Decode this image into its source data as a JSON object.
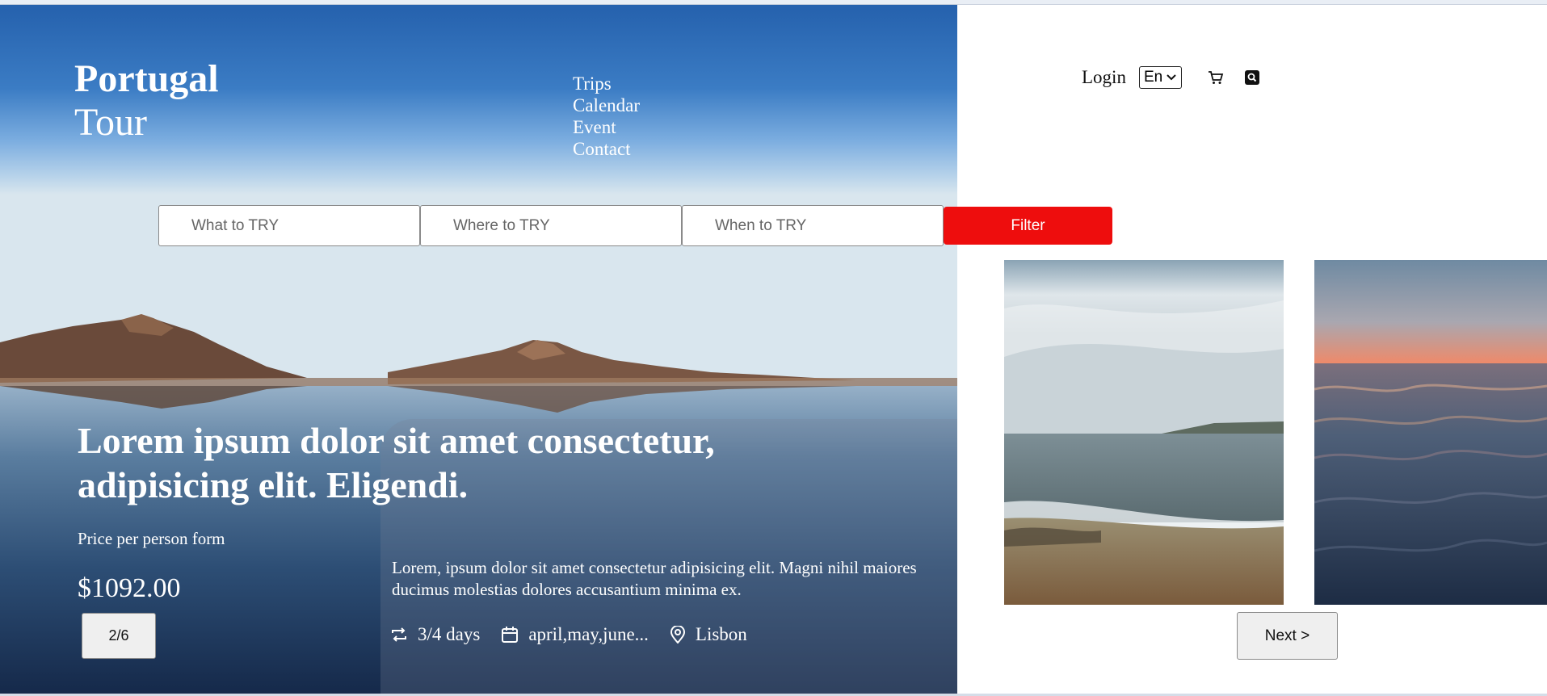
{
  "brand": {
    "line1": "Portugal",
    "line2": "Tour"
  },
  "nav": {
    "items": [
      "Trips",
      "Calendar",
      "Event",
      "Contact"
    ]
  },
  "topbar": {
    "login": "Login",
    "language": "En",
    "icons": [
      "cart-icon",
      "search-icon"
    ]
  },
  "search": {
    "what_placeholder": "What to TRY",
    "where_placeholder": "Where to TRY",
    "when_placeholder": "When to TRY",
    "filter_label": "Filter"
  },
  "hero": {
    "headline": "Lorem ipsum dolor sit amet consectetur, adipisicing elit. Eligendi.",
    "price_label": "Price per person form",
    "price": "$1092.00",
    "pager": "2/6",
    "description": "Lorem, ipsum dolor sit amet consectetur adipisicing elit. Magni nihil maiores ducimus molestias dolores accusantium minima ex.",
    "duration": "3/4 days",
    "months": "april,may,june...",
    "location": "Lisbon"
  },
  "gallery": {
    "next_label": "Next >"
  },
  "colors": {
    "accent": "#ee0d0d",
    "sky": "#2a66b0"
  }
}
